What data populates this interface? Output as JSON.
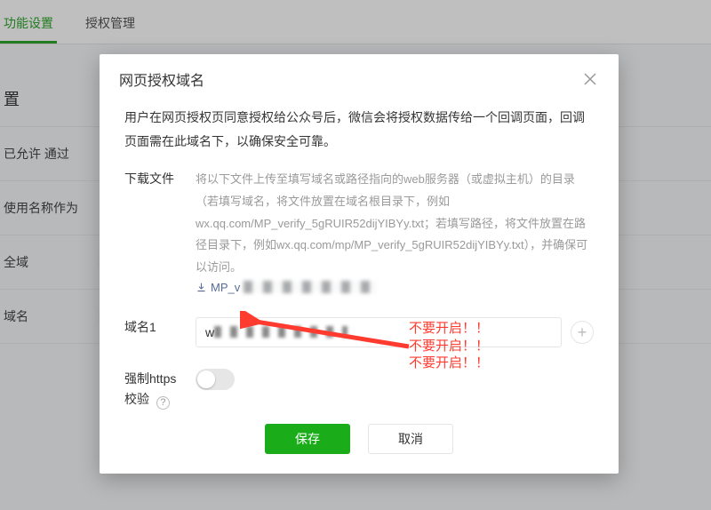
{
  "bg": {
    "tabs": [
      "功能设置",
      "授权管理"
    ],
    "section_title": "置",
    "rows": [
      {
        "label": "已允许 通过"
      },
      {
        "label": "使用名称作为"
      },
      {
        "label": "全域"
      },
      {
        "label": "域名"
      }
    ]
  },
  "modal": {
    "title": "网页授权域名",
    "intro": "用户在网页授权页同意授权给公众号后，微信会将授权数据传给一个回调页面，回调页面需在此域名下，以确保安全可靠。",
    "download": {
      "label": "下载文件",
      "hint": "将以下文件上传至填写域名或路径指向的web服务器（或虚拟主机）的目录（若填写域名，将文件放置在域名根目录下，例如wx.qq.com/MP_verify_5gRUIR52dijYIBYy.txt；若填写路径，将文件放置在路径目录下，例如wx.qq.com/mp/MP_verify_5gRUIR52dijYIBYy.txt），并确保可以访问。",
      "link_prefix": "MP_v"
    },
    "domain": {
      "label": "域名1",
      "value_prefix": "w",
      "add_aria": "添加域名"
    },
    "https": {
      "label_line1": "强制https",
      "label_line2": "校验",
      "help_char": "?"
    },
    "buttons": {
      "save": "保存",
      "cancel": "取消"
    }
  },
  "annotation": {
    "line": "不要开启！！"
  },
  "icons": {
    "close": "close-icon",
    "download": "download-icon",
    "add": "add-icon",
    "help": "help-icon",
    "arrow": "arrow-left-icon"
  },
  "colors": {
    "primary": "#1aad19",
    "danger": "#ff3b30",
    "link": "#576b95"
  }
}
